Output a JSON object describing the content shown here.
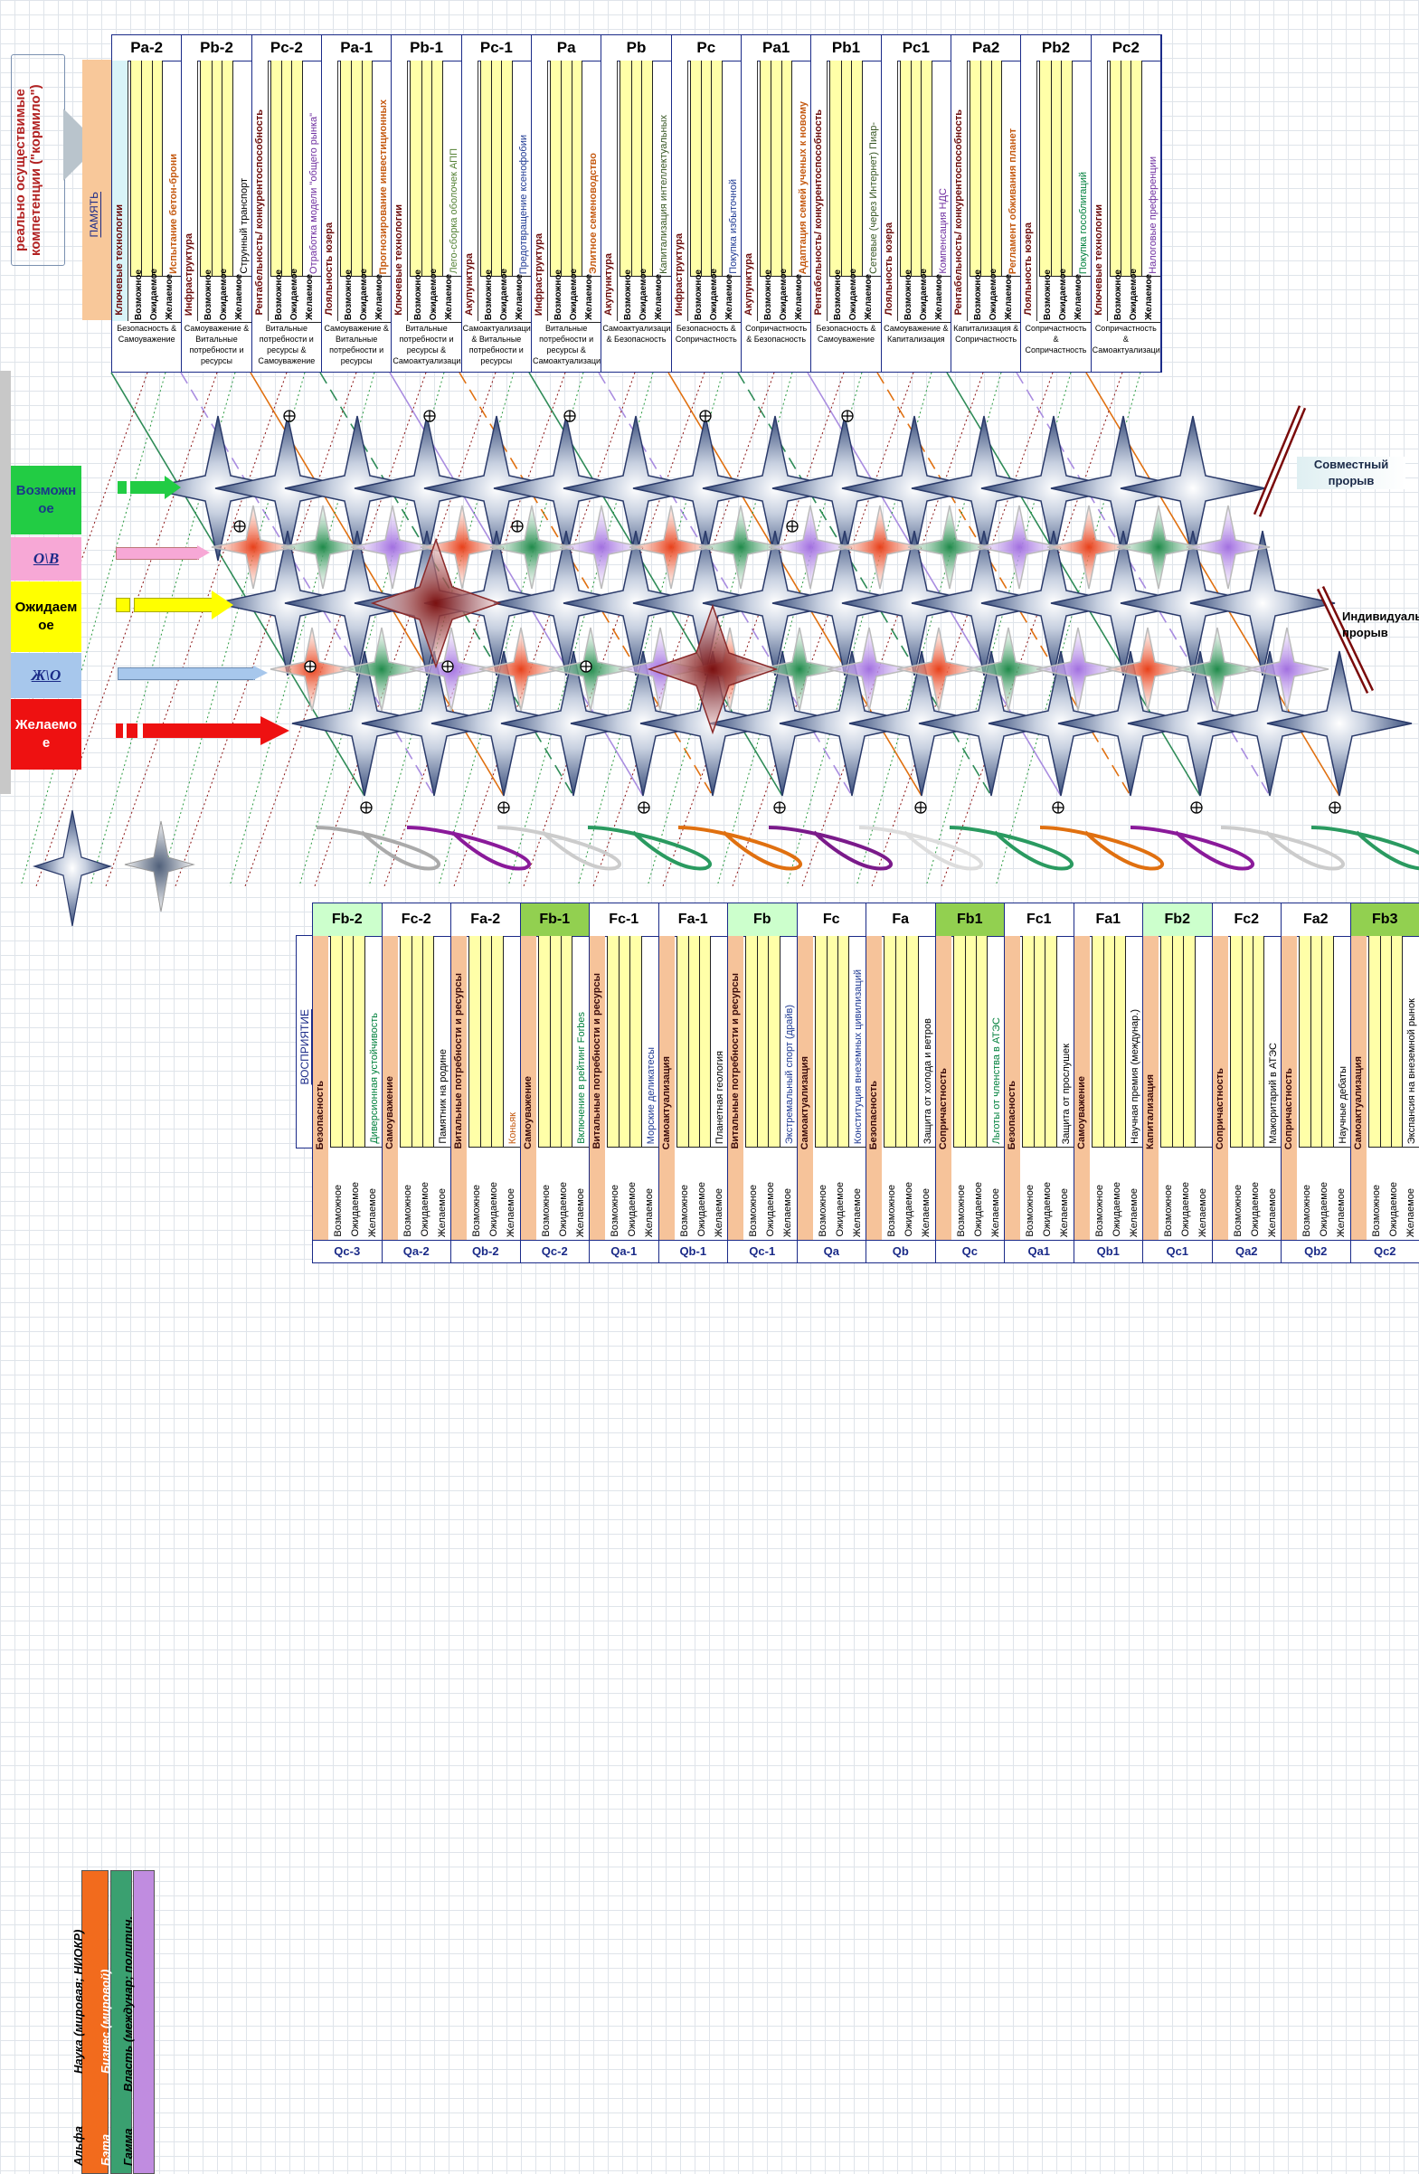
{
  "left_panel": {
    "title": "реально осуществимые компетенции (\"кормило\")",
    "memory_label": "ПАМЯТЬ"
  },
  "options": [
    "Возможное",
    "Ожидаемое",
    "Желаемое"
  ],
  "top_columns": [
    {
      "header": "Pa-2",
      "category": "Ключевые технологии",
      "side_text": "Испытание бетон-брони",
      "side_color": "#c55a11",
      "foot": "Безопасность & Самоуважение",
      "cat_color": "#d9f4f8"
    },
    {
      "header": "Pb-2",
      "category": "Инфраструктура",
      "side_text": "Струнный транспорт",
      "side_color": "#000000",
      "foot": "Самоуважение & Витальные потребности и ресурсы",
      "cat_color": "#ffffff"
    },
    {
      "header": "Pc-2",
      "category": "Рентабельность/ конкурентоспособность",
      "side_text": "Отработка модели \"общего рынка\"",
      "side_color": "#7030a0",
      "foot": "Витальные потребности и ресурсы & Самоуважение",
      "cat_color": "#ffffff"
    },
    {
      "header": "Pa-1",
      "category": "Лояльность юзера",
      "side_text": "Прогнозирование инвестиционных",
      "side_color": "#c55a11",
      "foot": "Самоуважение & Витальные потребности и ресурсы",
      "cat_color": "#ffffff"
    },
    {
      "header": "Pb-1",
      "category": "Ключевые технологии",
      "side_text": "Лего-сборка оболочек АПП",
      "side_color": "#548235",
      "foot": "Витальные потребности и ресурсы & Самоактуализация",
      "cat_color": "#ffffff"
    },
    {
      "header": "Pc-1",
      "category": "Акупунктура",
      "side_text": "Предотвращение ксенофобии",
      "side_color": "#1f3a93",
      "foot": "Самоактуализация & Витальные потребности и ресурсы",
      "cat_color": "#ffffff"
    },
    {
      "header": "Pa",
      "category": "Инфраструктура",
      "side_text": "Элитное семеноводство",
      "side_color": "#c55a11",
      "foot": "Витальные потребности и ресурсы & Самоактуализация",
      "cat_color": "#ffffff"
    },
    {
      "header": "Pb",
      "category": "Акупунктура",
      "side_text": "Капитализация интеллектуальных",
      "side_color": "#375623",
      "foot": "Самоактуализация & Безопасность",
      "cat_color": "#ffffff"
    },
    {
      "header": "Pc",
      "category": "Инфраструктура",
      "side_text": "Покупка избыточной",
      "side_color": "#1f3a93",
      "foot": "Безопасность & Сопричастность",
      "cat_color": "#ffffff"
    },
    {
      "header": "Pa1",
      "category": "Акупунктура",
      "side_text": "Адаптация семей ученых к новому",
      "side_color": "#c55a11",
      "foot": "Сопричастность & Безопасность",
      "cat_color": "#ffffff"
    },
    {
      "header": "Pb1",
      "category": "Рентабельность/ конкурентоспособность",
      "side_text": "Сетевые (через Интернет) Пиар-",
      "side_color": "#375623",
      "foot": "Безопасность & Самоуважение",
      "cat_color": "#ffffff"
    },
    {
      "header": "Pc1",
      "category": "Лояльность юзера",
      "side_text": "Компенсация НДС",
      "side_color": "#7030a0",
      "foot": "Самоуважение & Капитализация",
      "cat_color": "#ffffff"
    },
    {
      "header": "Pa2",
      "category": "Рентабельность/ конкурентоспособность",
      "side_text": "Регламент обживания планет",
      "side_color": "#c55a11",
      "foot": "Капитализация & Сопричастность",
      "cat_color": "#ffffff"
    },
    {
      "header": "Pb2",
      "category": "Лояльность юзера",
      "side_text": "Покупка гособлигаций",
      "side_color": "#00803c",
      "foot": "Сопричастность & Сопричастность",
      "cat_color": "#ffffff"
    },
    {
      "header": "Pc2",
      "category": "Ключевые технологии",
      "side_text": "Налоговые преференции",
      "side_color": "#7030a0",
      "foot": "Сопричастность & Самоактуализация",
      "cat_color": "#ffffff"
    }
  ],
  "rows": [
    {
      "label": "Возможное",
      "color": "#22cc44",
      "text_color": "#1a3a88"
    },
    {
      "label": "О\\В",
      "color": "#f7a8d6",
      "text_color": "#1a2a88"
    },
    {
      "label": "Ожидаемое",
      "color": "#ffff00",
      "text_color": "#000000"
    },
    {
      "label": "Ж\\О",
      "color": "#a7c7ec",
      "text_color": "#1a2a88"
    },
    {
      "label": "Желаемое",
      "color": "#ee1111",
      "text_color": "#ffffff"
    }
  ],
  "breakthroughs": {
    "joint": "Совместный прорыв",
    "individual": "Индивидуальный прорыв"
  },
  "legend": {
    "alpha": "Альфа",
    "beta": "Бэта",
    "gamma": "Гамма",
    "alpha_desc": "Наука (мировая; НИОКР)",
    "beta_desc": "Бизнес (мировой)",
    "gamma_desc": "Власть (междунар; политич.",
    "perception": "ВОСПРИЯТИЕ"
  },
  "bottom_columns": [
    {
      "header": "Fb-2",
      "category": "Безопасность",
      "side_text": "Диверсионная устойчивость",
      "side_color": "#00803c",
      "foot": "Qc-3",
      "hdr_color": "#ccffcc"
    },
    {
      "header": "Fc-2",
      "category": "Самоуважение",
      "side_text": "Памятник на родине",
      "side_color": "#000000",
      "foot": "Qa-2",
      "hdr_color": "#ffffff"
    },
    {
      "header": "Fa-2",
      "category": "Витальные потребности и ресурсы",
      "side_text": "Коньяк",
      "side_color": "#c55a11",
      "foot": "Qb-2",
      "hdr_color": "#ffffff"
    },
    {
      "header": "Fb-1",
      "category": "Самоуважение",
      "side_text": "Включение в рейтинг Forbes",
      "side_color": "#00803c",
      "foot": "Qc-2",
      "hdr_color": "#92d050"
    },
    {
      "header": "Fc-1",
      "category": "Витальные потребности и ресурсы",
      "side_text": "Морские деликатесы",
      "side_color": "#1f3a93",
      "foot": "Qa-1",
      "hdr_color": "#ffffff"
    },
    {
      "header": "Fa-1",
      "category": "Самоактуализация",
      "side_text": "Планетная геология",
      "side_color": "#000000",
      "foot": "Qb-1",
      "hdr_color": "#ffffff"
    },
    {
      "header": "Fb",
      "category": "Витальные потребности и ресурсы",
      "side_text": "Экстремальный спорт (драйв)",
      "side_color": "#1f3a93",
      "foot": "Qc-1",
      "hdr_color": "#ccffcc"
    },
    {
      "header": "Fc",
      "category": "Самоактуализация",
      "side_text": "Конституция внеземных цивилизаций",
      "side_color": "#1f3a93",
      "foot": "Qa",
      "hdr_color": "#ffffff"
    },
    {
      "header": "Fa",
      "category": "Безопасность",
      "side_text": "Защита от холода и ветров",
      "side_color": "#000000",
      "foot": "Qb",
      "hdr_color": "#ffffff"
    },
    {
      "header": "Fb1",
      "category": "Сопричастность",
      "side_text": "Льготы от членства в АТЭС",
      "side_color": "#00803c",
      "foot": "Qc",
      "hdr_color": "#92d050"
    },
    {
      "header": "Fc1",
      "category": "Безопасность",
      "side_text": "Защита от прослушек",
      "side_color": "#000000",
      "foot": "Qa1",
      "hdr_color": "#ffffff"
    },
    {
      "header": "Fa1",
      "category": "Самоуважение",
      "side_text": "Научная премия (междунар.)",
      "side_color": "#000000",
      "foot": "Qb1",
      "hdr_color": "#ffffff"
    },
    {
      "header": "Fb2",
      "category": "Капитализация",
      "side_text": "",
      "side_color": "#000000",
      "foot": "Qc1",
      "hdr_color": "#ccffcc"
    },
    {
      "header": "Fc2",
      "category": "Сопричастность",
      "side_text": "Мажоритарий в АТЭС",
      "side_color": "#000000",
      "foot": "Qa2",
      "hdr_color": "#ffffff"
    },
    {
      "header": "Fa2",
      "category": "Сопричастность",
      "side_text": "Научные дебаты",
      "side_color": "#000000",
      "foot": "Qb2",
      "hdr_color": "#ffffff"
    },
    {
      "header": "Fb3",
      "category": "Самоактуализация",
      "side_text": "Экспансия на внеземной рынок",
      "side_color": "#000000",
      "foot": "Qc2",
      "hdr_color": "#92d050"
    }
  ]
}
